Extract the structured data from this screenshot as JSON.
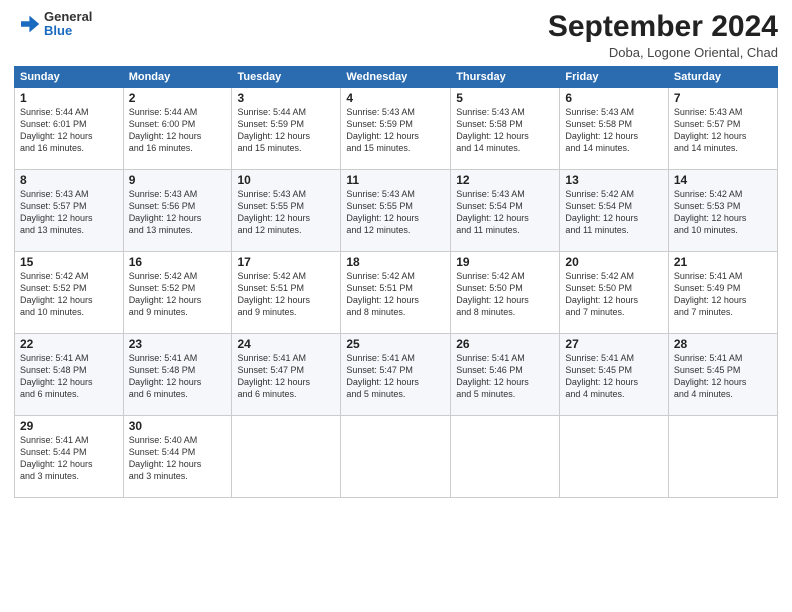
{
  "header": {
    "logo_general": "General",
    "logo_blue": "Blue",
    "month_title": "September 2024",
    "location": "Doba, Logone Oriental, Chad"
  },
  "days_of_week": [
    "Sunday",
    "Monday",
    "Tuesday",
    "Wednesday",
    "Thursday",
    "Friday",
    "Saturday"
  ],
  "weeks": [
    [
      {
        "day": "1",
        "info": "Sunrise: 5:44 AM\nSunset: 6:01 PM\nDaylight: 12 hours\nand 16 minutes."
      },
      {
        "day": "2",
        "info": "Sunrise: 5:44 AM\nSunset: 6:00 PM\nDaylight: 12 hours\nand 16 minutes."
      },
      {
        "day": "3",
        "info": "Sunrise: 5:44 AM\nSunset: 5:59 PM\nDaylight: 12 hours\nand 15 minutes."
      },
      {
        "day": "4",
        "info": "Sunrise: 5:43 AM\nSunset: 5:59 PM\nDaylight: 12 hours\nand 15 minutes."
      },
      {
        "day": "5",
        "info": "Sunrise: 5:43 AM\nSunset: 5:58 PM\nDaylight: 12 hours\nand 14 minutes."
      },
      {
        "day": "6",
        "info": "Sunrise: 5:43 AM\nSunset: 5:58 PM\nDaylight: 12 hours\nand 14 minutes."
      },
      {
        "day": "7",
        "info": "Sunrise: 5:43 AM\nSunset: 5:57 PM\nDaylight: 12 hours\nand 14 minutes."
      }
    ],
    [
      {
        "day": "8",
        "info": "Sunrise: 5:43 AM\nSunset: 5:57 PM\nDaylight: 12 hours\nand 13 minutes."
      },
      {
        "day": "9",
        "info": "Sunrise: 5:43 AM\nSunset: 5:56 PM\nDaylight: 12 hours\nand 13 minutes."
      },
      {
        "day": "10",
        "info": "Sunrise: 5:43 AM\nSunset: 5:55 PM\nDaylight: 12 hours\nand 12 minutes."
      },
      {
        "day": "11",
        "info": "Sunrise: 5:43 AM\nSunset: 5:55 PM\nDaylight: 12 hours\nand 12 minutes."
      },
      {
        "day": "12",
        "info": "Sunrise: 5:43 AM\nSunset: 5:54 PM\nDaylight: 12 hours\nand 11 minutes."
      },
      {
        "day": "13",
        "info": "Sunrise: 5:42 AM\nSunset: 5:54 PM\nDaylight: 12 hours\nand 11 minutes."
      },
      {
        "day": "14",
        "info": "Sunrise: 5:42 AM\nSunset: 5:53 PM\nDaylight: 12 hours\nand 10 minutes."
      }
    ],
    [
      {
        "day": "15",
        "info": "Sunrise: 5:42 AM\nSunset: 5:52 PM\nDaylight: 12 hours\nand 10 minutes."
      },
      {
        "day": "16",
        "info": "Sunrise: 5:42 AM\nSunset: 5:52 PM\nDaylight: 12 hours\nand 9 minutes."
      },
      {
        "day": "17",
        "info": "Sunrise: 5:42 AM\nSunset: 5:51 PM\nDaylight: 12 hours\nand 9 minutes."
      },
      {
        "day": "18",
        "info": "Sunrise: 5:42 AM\nSunset: 5:51 PM\nDaylight: 12 hours\nand 8 minutes."
      },
      {
        "day": "19",
        "info": "Sunrise: 5:42 AM\nSunset: 5:50 PM\nDaylight: 12 hours\nand 8 minutes."
      },
      {
        "day": "20",
        "info": "Sunrise: 5:42 AM\nSunset: 5:50 PM\nDaylight: 12 hours\nand 7 minutes."
      },
      {
        "day": "21",
        "info": "Sunrise: 5:41 AM\nSunset: 5:49 PM\nDaylight: 12 hours\nand 7 minutes."
      }
    ],
    [
      {
        "day": "22",
        "info": "Sunrise: 5:41 AM\nSunset: 5:48 PM\nDaylight: 12 hours\nand 6 minutes."
      },
      {
        "day": "23",
        "info": "Sunrise: 5:41 AM\nSunset: 5:48 PM\nDaylight: 12 hours\nand 6 minutes."
      },
      {
        "day": "24",
        "info": "Sunrise: 5:41 AM\nSunset: 5:47 PM\nDaylight: 12 hours\nand 6 minutes."
      },
      {
        "day": "25",
        "info": "Sunrise: 5:41 AM\nSunset: 5:47 PM\nDaylight: 12 hours\nand 5 minutes."
      },
      {
        "day": "26",
        "info": "Sunrise: 5:41 AM\nSunset: 5:46 PM\nDaylight: 12 hours\nand 5 minutes."
      },
      {
        "day": "27",
        "info": "Sunrise: 5:41 AM\nSunset: 5:45 PM\nDaylight: 12 hours\nand 4 minutes."
      },
      {
        "day": "28",
        "info": "Sunrise: 5:41 AM\nSunset: 5:45 PM\nDaylight: 12 hours\nand 4 minutes."
      }
    ],
    [
      {
        "day": "29",
        "info": "Sunrise: 5:41 AM\nSunset: 5:44 PM\nDaylight: 12 hours\nand 3 minutes."
      },
      {
        "day": "30",
        "info": "Sunrise: 5:40 AM\nSunset: 5:44 PM\nDaylight: 12 hours\nand 3 minutes."
      },
      {
        "day": "",
        "info": ""
      },
      {
        "day": "",
        "info": ""
      },
      {
        "day": "",
        "info": ""
      },
      {
        "day": "",
        "info": ""
      },
      {
        "day": "",
        "info": ""
      }
    ]
  ]
}
